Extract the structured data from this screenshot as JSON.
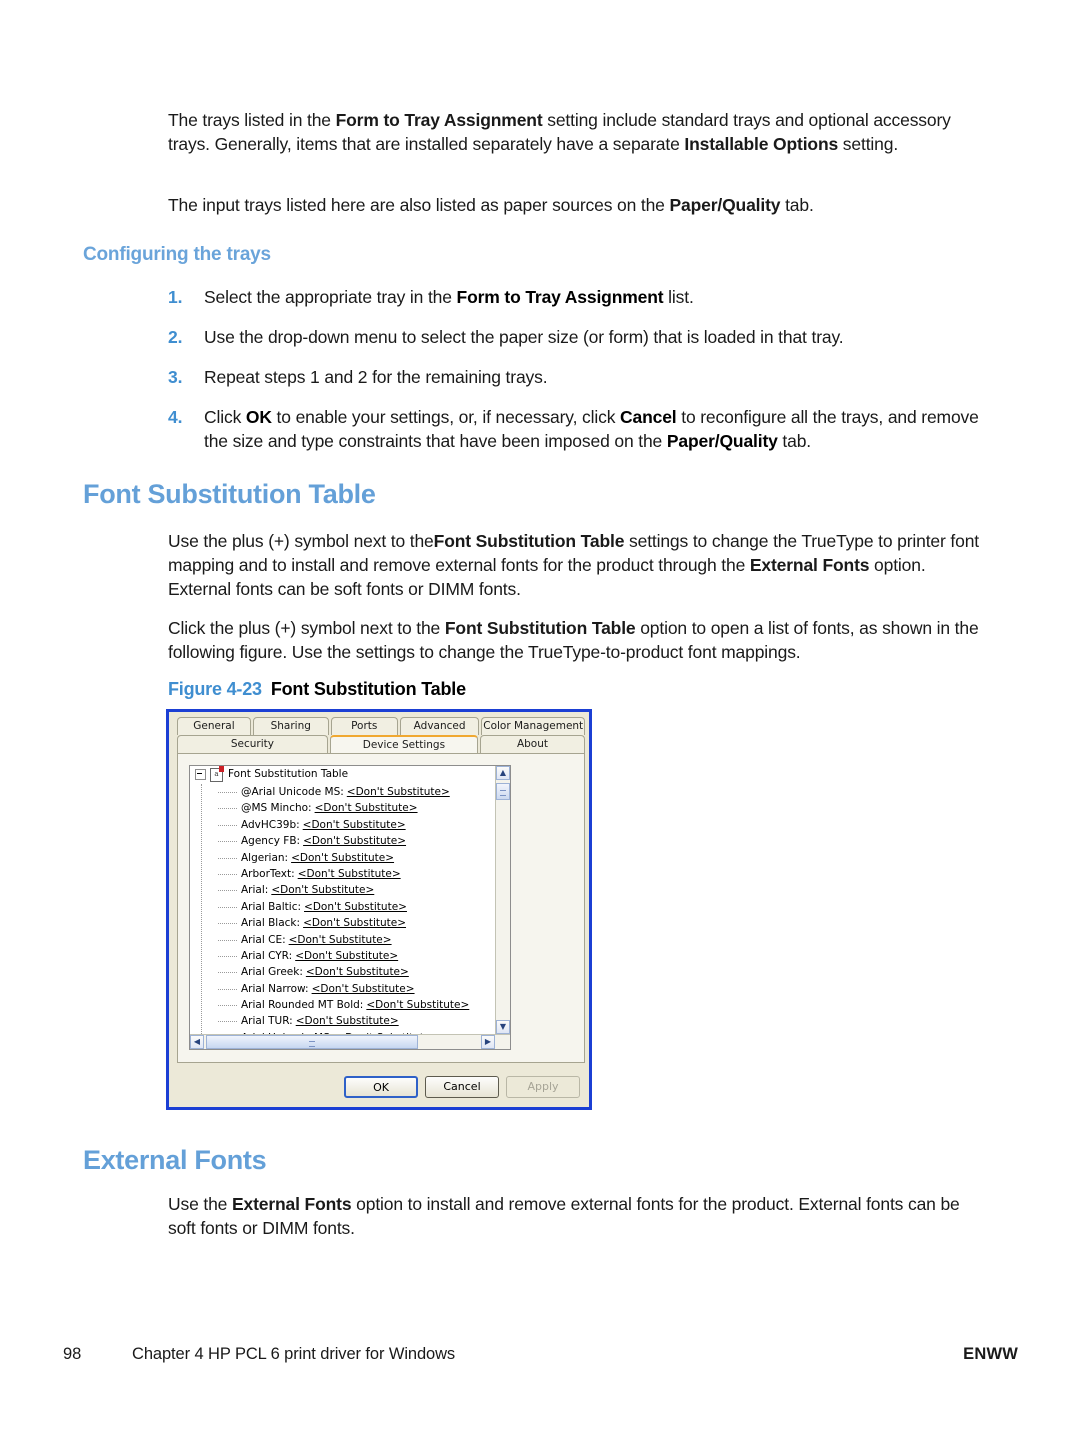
{
  "intro": {
    "para1_pre": "The trays listed in the ",
    "para1_b1": "Form to Tray Assignment",
    "para1_mid": " setting include standard trays and optional accessory trays. Generally, items that are installed separately have a separate ",
    "para1_b2": "Installable Options",
    "para1_post": " setting.",
    "para2_pre": "The input trays listed here are also listed as paper sources on the ",
    "para2_b1": "Paper/Quality",
    "para2_post": " tab."
  },
  "configuring": {
    "heading": "Configuring the trays",
    "steps": [
      {
        "num": "1.",
        "pre": "Select the appropriate tray in the ",
        "bold": "Form to Tray Assignment",
        "post": " list."
      },
      {
        "num": "2.",
        "pre": "Use the drop-down menu to select the paper size (or form) that is loaded in that tray.",
        "bold": "",
        "post": ""
      },
      {
        "num": "3.",
        "pre": "Repeat steps 1 and 2 for the remaining trays.",
        "bold": "",
        "post": ""
      },
      {
        "num": "4.",
        "pre": "Click ",
        "bold": "OK",
        "mid1": " to enable your settings, or, if necessary, click ",
        "bold2": "Cancel",
        "mid2": " to reconfigure all the trays, and remove the size and type constraints that have been imposed on the ",
        "bold3": "Paper/Quality",
        "post": " tab."
      }
    ]
  },
  "font_substitution": {
    "heading": "Font Substitution Table",
    "para1_pre": "Use the plus (+) symbol next to the",
    "para1_b1": "Font Substitution Table",
    "para1_mid": " settings to change the TrueType to printer font mapping and to install and remove external fonts for the product through the ",
    "para1_b2": "External Fonts",
    "para1_post": " option. External fonts can be soft fonts or DIMM fonts.",
    "para2_pre": "Click the plus (+) symbol next to the ",
    "para2_b1": "Font Substitution Table",
    "para2_post": " option to open a list of fonts, as shown in the following figure. Use the settings to change the TrueType-to-product font mappings."
  },
  "figure": {
    "number": "Figure 4-23",
    "title": "Font Substitution Table"
  },
  "dialog": {
    "tabs_row1": [
      {
        "label": "General",
        "active": false
      },
      {
        "label": "Sharing",
        "active": false
      },
      {
        "label": "Ports",
        "active": false
      },
      {
        "label": "Advanced",
        "active": false
      },
      {
        "label": "Color Management",
        "active": false
      }
    ],
    "tabs_row2": [
      {
        "label": "Security",
        "active": false
      },
      {
        "label": "Device Settings",
        "active": true
      },
      {
        "label": "About",
        "active": false
      }
    ],
    "tree_root": "Font Substitution Table",
    "tree_root_icon_letter": "a",
    "substitute_value": "<Don't Substitute>",
    "fonts": [
      "@Arial Unicode MS:",
      "@MS Mincho:",
      "AdvHC39b:",
      "Agency FB:",
      "Algerian:",
      "ArborText:",
      "Arial:",
      "Arial Baltic:",
      "Arial Black:",
      "Arial CE:",
      "Arial CYR:",
      "Arial Greek:",
      "Arial Narrow:",
      "Arial Rounded MT Bold:",
      "Arial TUR:",
      "Arial Unicode MS:"
    ],
    "buttons": {
      "ok": "OK",
      "cancel": "Cancel",
      "apply": "Apply"
    },
    "scroll_glyphs": {
      "up": "▲",
      "down": "▼",
      "left": "◀",
      "right": "▶"
    },
    "border_color": "#1b3fd4",
    "face_color": "#ece9d8",
    "active_tab_accent": "#f0a830"
  },
  "external_fonts": {
    "heading": "External Fonts",
    "para_pre": "Use the ",
    "para_b1": "External Fonts",
    "para_post": " option to install and remove external fonts for the product. External fonts can be soft fonts or DIMM fonts."
  },
  "footer": {
    "page_number": "98",
    "chapter": "Chapter 4   HP PCL 6 print driver for Windows",
    "locale": "ENWW"
  },
  "colors": {
    "heading_blue": "#64a0d8",
    "sub_heading_blue": "#6aa4da",
    "step_number_blue": "#3f8ed0"
  }
}
